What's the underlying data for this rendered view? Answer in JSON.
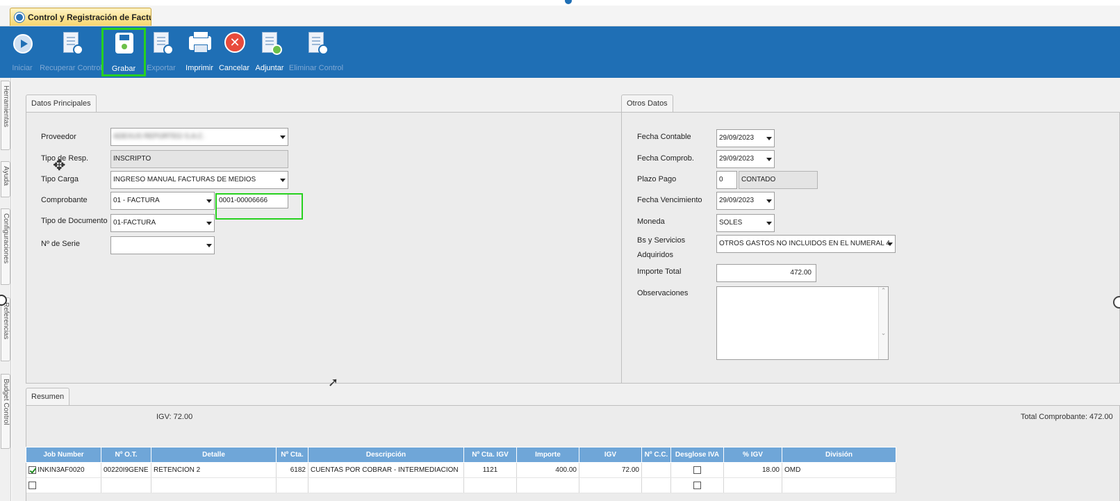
{
  "window": {
    "tab_title": "Control y Registración de Factura..."
  },
  "toolbar": {
    "buttons": [
      {
        "label": "Iniciar"
      },
      {
        "label": "Recuperar Control"
      },
      {
        "label": "Grabar"
      },
      {
        "label": "Exportar"
      },
      {
        "label": "Imprimir"
      },
      {
        "label": "Cancelar"
      },
      {
        "label": "Adjuntar"
      },
      {
        "label": "Eliminar Control"
      }
    ]
  },
  "side_tabs": [
    "Herramientas",
    "Ayuda",
    "Configuraciones",
    "Referencias",
    "Budget Control"
  ],
  "principal": {
    "tab_label": "Datos Principales",
    "proveedor_label": "Proveedor",
    "proveedor_value": "ADEXUS REPORTEO S.A.C.",
    "tipo_resp_label": "Tipo de Resp.",
    "tipo_resp_value": "INSCRIPTO",
    "tipo_carga_label": "Tipo Carga",
    "tipo_carga_value": "INGRESO MANUAL FACTURAS DE MEDIOS",
    "comprobante_label": "Comprobante",
    "comprobante_value": "01 - FACTURA",
    "comprobante_numero": "0001-00006666",
    "tipo_doc_label": "Tipo de Documento",
    "tipo_doc_value": "01-FACTURA",
    "serie_label": "Nº de Serie",
    "serie_value": ""
  },
  "otros": {
    "tab_label": "Otros Datos",
    "fecha_contable_label": "Fecha Contable",
    "fecha_contable_value": "29/09/2023",
    "fecha_comprob_label": "Fecha Comprob.",
    "fecha_comprob_value": "29/09/2023",
    "plazo_label": "Plazo Pago",
    "plazo_value": "0",
    "plazo_desc": "CONTADO",
    "vencimiento_label": "Fecha Vencimiento",
    "vencimiento_value": "29/09/2023",
    "moneda_label": "Moneda",
    "moneda_value": "SOLES",
    "bienes_label_1": "Bs y Servicios",
    "bienes_label_2": "Adquiridos",
    "bienes_value": "OTROS GASTOS NO INCLUIDOS EN EL NUMERAL 4",
    "importe_label": "Importe Total",
    "importe_value": "472.00",
    "observaciones_label": "Observaciones",
    "observaciones_value": ""
  },
  "resumen": {
    "tab_label": "Resumen",
    "igv_text": "IGV: 72.00",
    "total_text": "Total Comprobante: 472.00",
    "columns": [
      "Job Number",
      "Nº O.T.",
      "Detalle",
      "Nº Cta.",
      "Descripción",
      "Nº Cta. IGV",
      "Importe",
      "IGV",
      "Nº C.C.",
      "Desglose IVA",
      "% IGV",
      "División"
    ],
    "rows": [
      {
        "checked": true,
        "job": "INKIN3AF0020",
        "ot": "00220I9GENE",
        "detalle": "RETENCION 2",
        "cta": "6182",
        "descripcion": "CUENTAS POR COBRAR - INTERMEDIACION",
        "cta_igv": "1121",
        "importe": "400.00",
        "igv": "72.00",
        "cc": "",
        "desglose": false,
        "pct_igv": "18.00",
        "division": "OMD"
      },
      {
        "checked": false,
        "job": "",
        "ot": "",
        "detalle": "",
        "cta": "",
        "descripcion": "",
        "cta_igv": "",
        "importe": "",
        "igv": "",
        "cc": "",
        "desglose": false,
        "pct_igv": "",
        "division": ""
      }
    ]
  }
}
